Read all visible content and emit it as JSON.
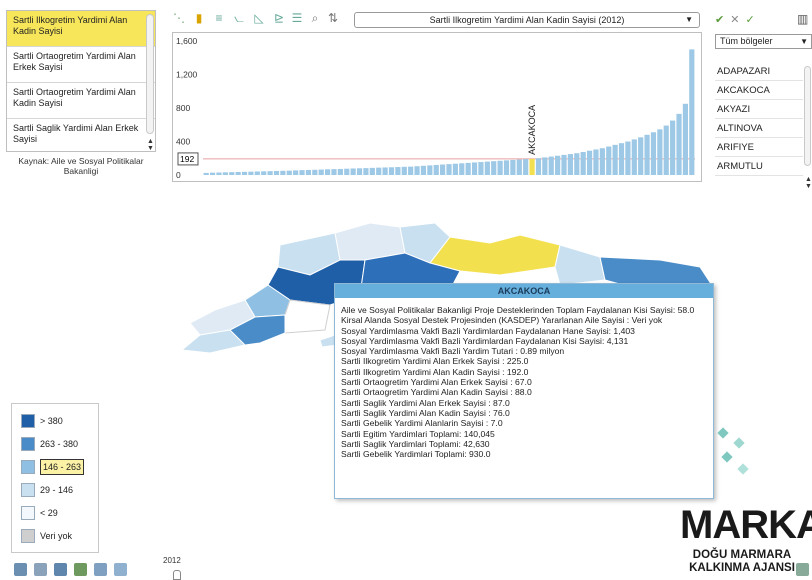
{
  "indicators": {
    "items": [
      "Sartli Ilkogretim Yardimi Alan Kadin Sayisi",
      "Sartli Ortaogretim Yardimi Alan Erkek Sayisi",
      "Sartli Ortaogretim Yardimi Alan Kadin Sayisi",
      "Sartli Saglik Yardimi Alan Erkek Sayisi"
    ],
    "selected_index": 0,
    "source": "Kaynak: Aile ve Sosyal Politikalar Bakanligi"
  },
  "toolbar": {
    "icons": [
      "scatter-icon",
      "bar-chart-icon",
      "horizontal-bar-icon",
      "line-chart-icon",
      "area-chart-icon",
      "stacked-icon",
      "legend-list-icon",
      "zoom-icon",
      "sort-icon"
    ],
    "indicator_select": "Sartli Ilkogretim Yardimi Alan Kadin Sayisi  (2012)"
  },
  "chart_data": {
    "type": "bar",
    "title": "Sartli Ilkogretim Yardimi Alan Kadin Sayisi  (2012)",
    "y_ticks": [
      "1,600",
      "1,200",
      "800",
      "400",
      "0"
    ],
    "ylim": [
      0,
      1600
    ],
    "highlight_category": "AKCAKOCA",
    "highlight_value_label": "192",
    "values": [
      25,
      28,
      30,
      32,
      34,
      36,
      38,
      40,
      42,
      44,
      46,
      48,
      50,
      52,
      55,
      58,
      60,
      62,
      65,
      68,
      70,
      72,
      75,
      78,
      80,
      82,
      85,
      88,
      90,
      92,
      95,
      98,
      100,
      105,
      110,
      115,
      120,
      125,
      130,
      135,
      140,
      145,
      150,
      155,
      160,
      165,
      170,
      175,
      180,
      185,
      190,
      192,
      200,
      210,
      220,
      230,
      240,
      250,
      260,
      275,
      290,
      305,
      320,
      340,
      360,
      380,
      400,
      425,
      450,
      480,
      510,
      545,
      590,
      650,
      730,
      850,
      1500
    ],
    "highlight_index": 51,
    "colors": {
      "bar": "#9ec9e6",
      "highlight": "#f3e04f",
      "ref_line": "#e8a0a0"
    }
  },
  "regions": {
    "filter": "Tüm bölgeler",
    "items": [
      "ADAPAZARI",
      "AKCAKOCA",
      "AKYAZI",
      "ALTINOVA",
      "ARIFIYE",
      "ARMUTLU"
    ]
  },
  "tooltip": {
    "title": "AKCAKOCA",
    "lines": [
      "Aile ve Sosyal Politikalar Bakanligi Proje Desteklerinden Toplam Faydalanan Kisi Sayisi: 58.0",
      "Kirsal Alanda Sosyal Destek Projesinden (KASDEP) Yararlanan Aile Sayisi : Veri yok",
      "Sosyal Yardimlasma Vakfi Bazli Yardimlardan Faydalanan Hane Sayisi: 1,403",
      "Sosyal Yardimlasma Vakfi Bazli Yardimlardan Faydalanan Kisi Sayisi: 4,131",
      "Sosyal Yardimlasma Vakfi Bazli Yardim Tutari : 0.89 milyon",
      "Sartli Ilkogretim Yardimi Alan Erkek Sayisi : 225.0",
      "Sartli Ilkogretim Yardimi Alan Kadin Sayisi : 192.0",
      "Sartli Ortaogretim Yardimi Alan Erkek Sayisi : 67.0",
      "Sartli Ortaogretim Yardimi Alan Kadin Sayisi : 88.0",
      "Sartli Saglik Yardimi Alan Erkek Sayisi : 87.0",
      "Sartli Saglik Yardimi Alan Kadin Sayisi : 76.0",
      "Sartli Gebelik Yardimi Alanlarin Sayisi : 7.0",
      "Sartli Egitim Yardimlari Toplami: 140,045",
      "Sartli Saglik Yardimlari Toplami: 42,630",
      "Sartli Gebelik Yardimlari Toplami: 930.0"
    ]
  },
  "legend": {
    "items": [
      {
        "label": "> 380",
        "color": "#1f5fa8"
      },
      {
        "label": "263 - 380",
        "color": "#4a8cc8"
      },
      {
        "label": "146 - 263",
        "color": "#8fc0e3"
      },
      {
        "label": "29 - 146",
        "color": "#c9e0f1"
      },
      {
        "label": "< 29",
        "color": "#f3f8fc"
      },
      {
        "label": "Veri yok",
        "color": "#cfcfcf"
      }
    ],
    "highlighted_index": 2
  },
  "timeline": {
    "year": "2012"
  },
  "logo": {
    "main": "MARKA",
    "line1": "DOĞU MARMARA",
    "line2": "KALKINMA AJANSI"
  }
}
